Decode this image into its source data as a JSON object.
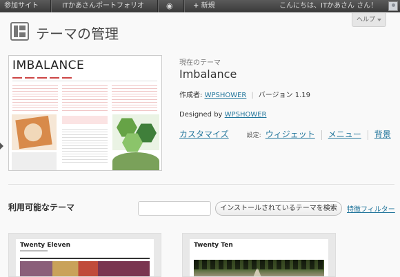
{
  "admin_bar": {
    "site_name": "参加サイト",
    "portfolio": "ITかあさんポートフォリオ",
    "comments_icon": "speech-bubble-icon",
    "new_label": "新規",
    "greeting": "こんにちは、ITかあさん さん！"
  },
  "help": {
    "label": "ヘルプ"
  },
  "page": {
    "title": "テーマの管理",
    "title_icon": "appearance-icon"
  },
  "current_theme": {
    "section_label": "現在のテーマ",
    "name": "Imbalance",
    "screenshot_logo": "IMBALANCE",
    "author_label": "作成者:",
    "author": "WPSHOWER",
    "version": "バージョン 1.19",
    "designed_by_label": "Designed by",
    "designed_by": "WPSHOWER",
    "customize": "カスタマイズ",
    "settings_label": "設定:",
    "widgets": "ウィジェット",
    "menus": "メニュー",
    "background": "背景"
  },
  "available": {
    "heading": "利用可能なテーマ",
    "search_value": "",
    "search_button": "インストールされているテーマを検索",
    "feature_filter": "特徴フィルター"
  },
  "themes": [
    {
      "name": "Twenty Eleven"
    },
    {
      "name": "Twenty Ten"
    }
  ],
  "colors": {
    "link": "#21759b",
    "admin_bar": "#464646"
  }
}
